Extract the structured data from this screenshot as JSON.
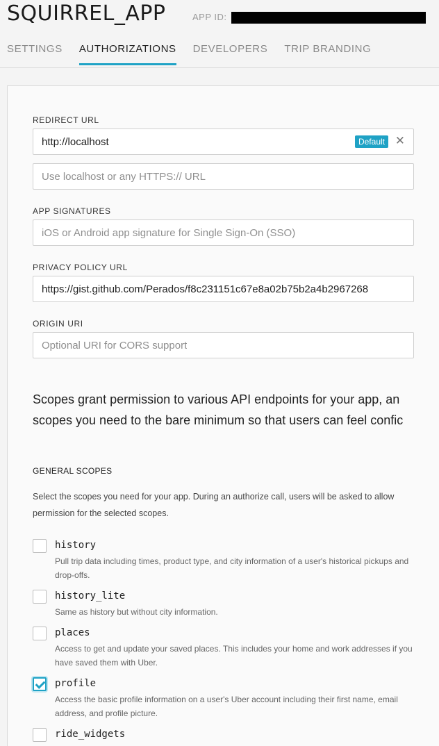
{
  "header": {
    "app_title": "SQUIRREL_APP",
    "app_id_label": "APP ID:",
    "tabs": [
      {
        "label": "SETTINGS"
      },
      {
        "label": "AUTHORIZATIONS"
      },
      {
        "label": "DEVELOPERS"
      },
      {
        "label": "TRIP BRANDING"
      }
    ],
    "active_tab": "AUTHORIZATIONS",
    "accent_color": "#1fa2c5"
  },
  "form": {
    "redirect_url": {
      "label": "REDIRECT URL",
      "value": "http://localhost",
      "badge": "Default",
      "remove_icon": "close-icon",
      "new_placeholder": "Use localhost or any HTTPS:// URL"
    },
    "app_signatures": {
      "label": "APP SIGNATURES",
      "placeholder": "iOS or Android app signature for Single Sign-On (SSO)"
    },
    "privacy_policy_url": {
      "label": "PRIVACY POLICY URL",
      "value": "https://gist.github.com/Perados/f8c231151c67e8a02b75b2a4b2967268"
    },
    "origin_uri": {
      "label": "ORIGIN URI",
      "placeholder": "Optional URI for CORS support"
    }
  },
  "scopes": {
    "intro_line1": "Scopes grant permission to various API endpoints for your app, an",
    "intro_line2": "scopes you need to the bare minimum so that users can feel confic",
    "general_title": "GENERAL SCOPES",
    "general_desc": "Select the scopes you need for your app. During an authorize call, users will be asked to allow permission for the selected scopes.",
    "items": [
      {
        "name": "history",
        "checked": false,
        "desc": "Pull trip data including times, product type, and city information of a user's historical pickups and drop-offs."
      },
      {
        "name": "history_lite",
        "checked": false,
        "desc": "Same as history but without city information."
      },
      {
        "name": "places",
        "checked": false,
        "desc": "Access to get and update your saved places. This includes your home and work addresses if you have saved them with Uber."
      },
      {
        "name": "profile",
        "checked": true,
        "desc": "Access the basic profile information on a user's Uber account including their first name, email address, and profile picture."
      },
      {
        "name": "ride_widgets",
        "checked": false,
        "desc": ""
      }
    ]
  }
}
